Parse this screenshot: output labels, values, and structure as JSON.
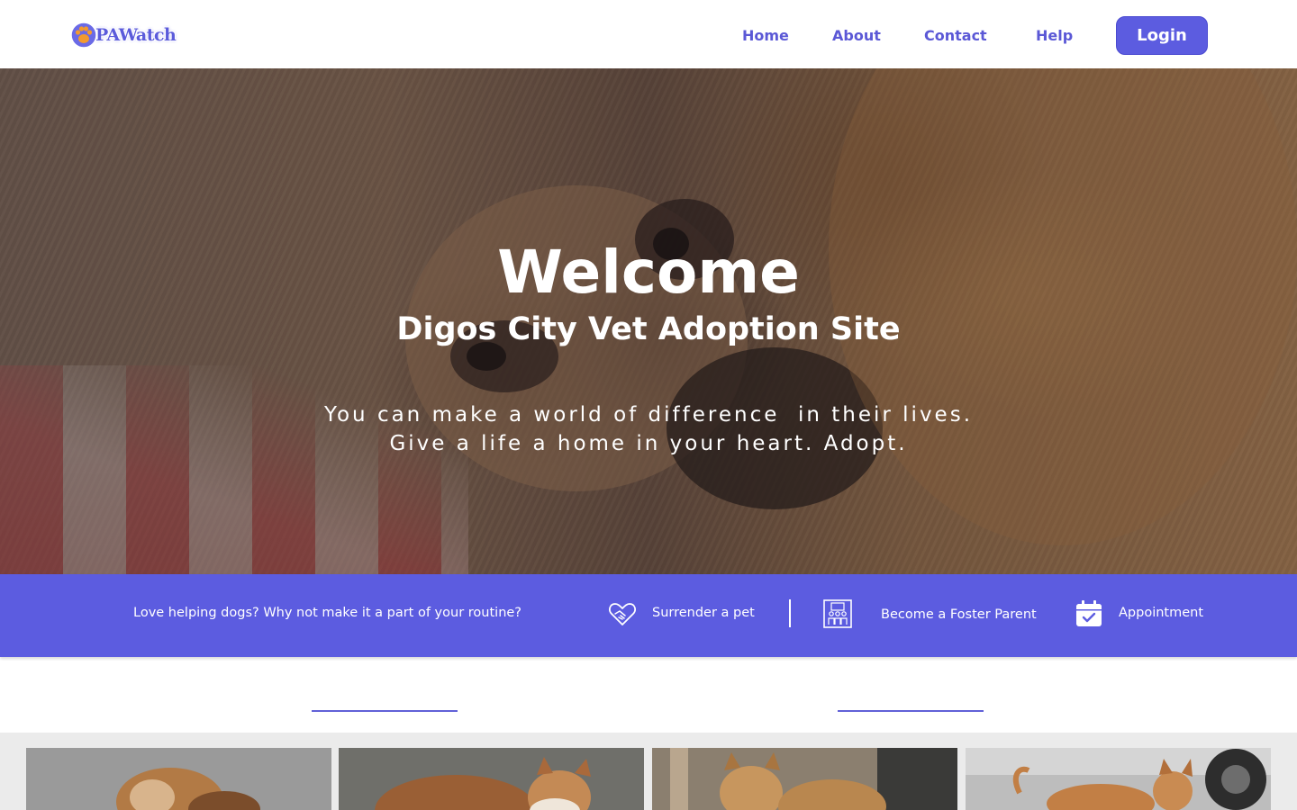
{
  "header": {
    "logo_text": "PAWatch",
    "nav": [
      "Home",
      "About",
      "Contact",
      "Help"
    ],
    "login_label": "Login"
  },
  "hero": {
    "title": "Welcome",
    "subtitle": "Digos City Vet Adoption Site",
    "tagline_line1": "You can make a world of difference  in their lives.",
    "tagline_line2": "Give a life a home in your heart. Adopt."
  },
  "banner": {
    "text": "Love helping dogs? Why not make it a part of your routine?",
    "links": [
      {
        "label": "Surrender a pet",
        "icon": "handshake-heart-icon"
      },
      {
        "label": "Become a Foster Parent",
        "icon": "family-frame-icon"
      },
      {
        "label": "Appointment",
        "icon": "calendar-check-icon"
      }
    ]
  },
  "colors": {
    "accent": "#5c5ce0",
    "nav_text": "#5b58d6",
    "strip_bg": "#ebebeb"
  }
}
